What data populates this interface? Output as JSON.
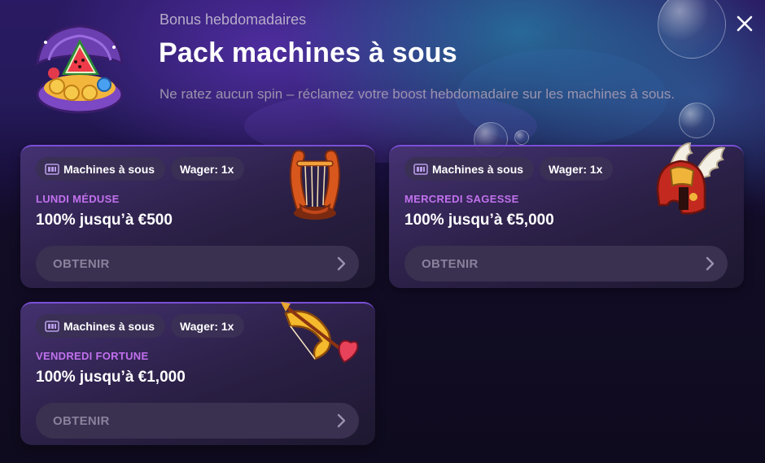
{
  "header": {
    "subtitle": "Bonus hebdomadaires",
    "title": "Pack machines à sous",
    "description": "Ne ratez aucun spin – réclamez votre boost hebdomadaire sur les machines à sous.",
    "hero_icon": "treasure-shell-watermelon-icon",
    "close_icon": "close-icon"
  },
  "colors": {
    "accent": "#c171ee",
    "card_border": "#7a4fd6",
    "button_bg": "#3a3050",
    "button_text": "#8a819c"
  },
  "cards": [
    {
      "category_tag": "Machines à sous",
      "wager_tag": "Wager: 1x",
      "day": "LUNDI MÉDUSE",
      "offer": "100% jusqu’à €500",
      "button": "OBTENIR",
      "art_icon": "lyre-icon"
    },
    {
      "category_tag": "Machines à sous",
      "wager_tag": "Wager: 1x",
      "day": "MERCREDI SAGESSE",
      "offer": "100% jusqu’à €5,000",
      "button": "OBTENIR",
      "art_icon": "winged-helmet-icon"
    },
    {
      "category_tag": "Machines à sous",
      "wager_tag": "Wager: 1x",
      "day": "VENDREDI FORTUNE",
      "offer": "100% jusqu’à €1,000",
      "button": "OBTENIR",
      "art_icon": "bow-arrow-heart-icon"
    }
  ]
}
